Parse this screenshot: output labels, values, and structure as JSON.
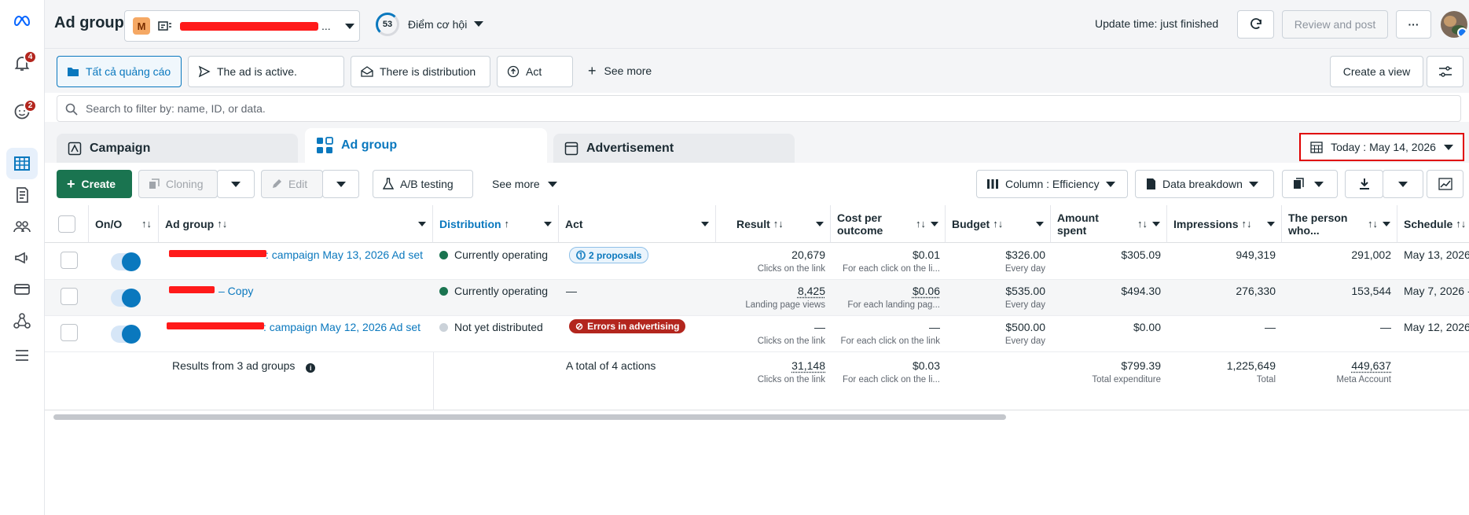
{
  "header": {
    "title": "Ad group",
    "account_initial": "M",
    "account_suffix": "...",
    "score_value": "53",
    "score_label": "Điểm cơ hội",
    "update_text": "Update time: just finished",
    "review_label": "Review and post",
    "more_label": "···"
  },
  "rail": {
    "notification_count": "4",
    "messages_count": "2"
  },
  "filters": {
    "chips": [
      "Tất cả quảng cáo",
      "The ad is active.",
      "There is distribution",
      "Act"
    ],
    "see_more": "See more",
    "create_view": "Create a view"
  },
  "search": {
    "placeholder": "Search to filter by: name, ID, or data."
  },
  "tabs": {
    "campaign": "Campaign",
    "ad_group": "Ad group",
    "advertisement": "Advertisement"
  },
  "date_range": "Today : May 14, 2026",
  "toolbar": {
    "create": "Create",
    "cloning": "Cloning",
    "edit": "Edit",
    "ab_testing": "A/B testing",
    "see_more": "See more",
    "columns": "Column : Efficiency",
    "breakdown": "Data breakdown"
  },
  "table": {
    "headers": {
      "onoff": "On/O",
      "ad_group": "Ad group",
      "distribution": "Distribution",
      "act": "Act",
      "result": "Result",
      "cost_per_outcome_1": "Cost per",
      "cost_per_outcome_2": "outcome",
      "budget": "Budget",
      "amount_spent_1": "Amount",
      "amount_spent_2": "spent",
      "impressions": "Impressions",
      "reach_1": "The person",
      "reach_2": "who...",
      "schedule": "Schedule"
    },
    "rows": [
      {
        "name": ": campaign May 13, 2026 Ad set",
        "distribution": "Currently operating",
        "act": "2 proposals",
        "result": "20,679",
        "result_sub": "Clicks on the link",
        "cost": "$0.01",
        "cost_sub": "For each click on the li...",
        "budget": "$326.00",
        "budget_sub": "Every day",
        "spent": "$305.09",
        "impressions": "949,319",
        "reach": "291,002",
        "schedule": "May 13, 2026"
      },
      {
        "name": "– Copy",
        "distribution": "Currently operating",
        "act": "—",
        "result": "8,425",
        "result_sub": "Landing page views",
        "cost": "$0.06",
        "cost_sub": "For each landing pag...",
        "budget": "$535.00",
        "budget_sub": "Every day",
        "spent": "$494.30",
        "impressions": "276,330",
        "reach": "153,544",
        "schedule": "May 7, 2026 -"
      },
      {
        "name": ": campaign May 12, 2026 Ad set",
        "distribution": "Not yet distributed",
        "act": "Errors in advertising",
        "result": "—",
        "result_sub": "Clicks on the link",
        "cost": "—",
        "cost_sub": "For each click on the link",
        "budget": "$500.00",
        "budget_sub": "Every day",
        "spent": "$0.00",
        "impressions": "—",
        "reach": "—",
        "schedule": "May 12, 2026"
      }
    ],
    "summary": {
      "label": "Results from 3 ad groups",
      "act": "A total of 4 actions",
      "result": "31,148",
      "result_sub": "Clicks on the link",
      "cost": "$0.03",
      "cost_sub": "For each click on the li...",
      "spent": "$799.39",
      "spent_sub": "Total expenditure",
      "impressions": "1,225,649",
      "impressions_sub": "Total",
      "reach": "449,637",
      "reach_sub": "Meta Account"
    }
  },
  "colors": {
    "accent": "#0a78be",
    "create_green": "#1a7450",
    "status_active": "#1a7450",
    "status_inactive": "#cbd2d9",
    "error_red": "#b3261e",
    "redaction": "#ff1a1a",
    "account_orange": "#f5a864"
  }
}
